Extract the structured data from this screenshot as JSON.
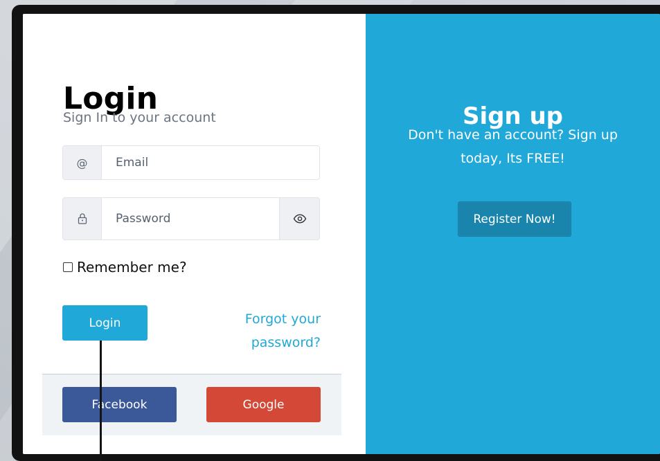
{
  "login": {
    "title": "Login",
    "subtitle": "Sign In to your account",
    "email": {
      "icon": "at-icon",
      "icon_glyph": "@",
      "placeholder": "Email",
      "value": ""
    },
    "password": {
      "icon": "lock-icon",
      "placeholder": "Password",
      "value": "",
      "toggle_icon": "eye-icon"
    },
    "remember_label": "Remember me?",
    "remember_checked": false,
    "login_button": "Login",
    "forgot_link": "Forgot your password?"
  },
  "social": {
    "facebook_label": "Facebook",
    "google_label": "Google"
  },
  "signup": {
    "title": "Sign up",
    "text": "Don't have an account? Sign up today, Its FREE!",
    "register_button": "Register Now!"
  },
  "colors": {
    "primary": "#20a8d8",
    "facebook": "#3b5998",
    "google": "#d34836",
    "register_button": "#1985ac"
  }
}
